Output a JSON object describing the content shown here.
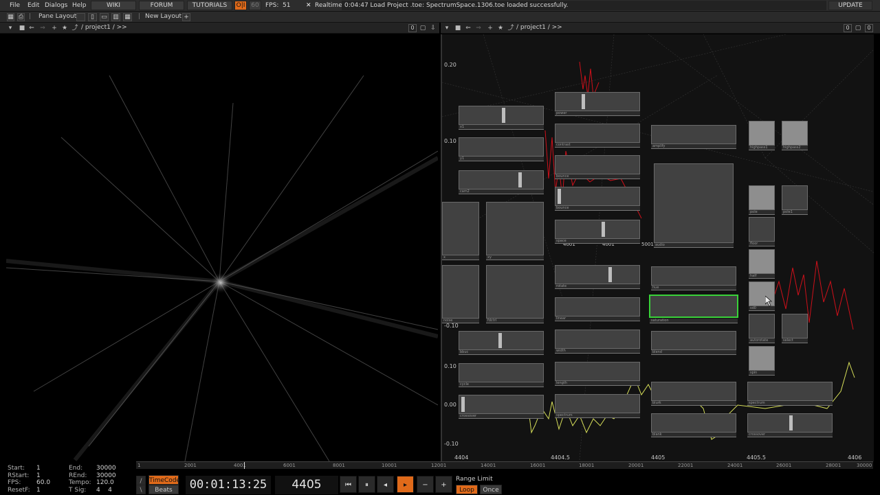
{
  "menu": {
    "file": "File",
    "edit": "Edit",
    "dialogs": "Dialogs",
    "help": "Help",
    "wiki": "WIKI",
    "forum": "FORUM",
    "tutorials": "TUTORIALS",
    "oi": "O|I",
    "fps_cap": "60",
    "fps_label": "FPS:",
    "fps_value": "51",
    "realtime": "Realtime",
    "status": "0:04:47 Load Project .toe: SpectrumSpace.1306.toe loaded successfully.",
    "update": "UPDATE"
  },
  "panebar": {
    "pane_layout": "Pane Layout",
    "new_layout": "New Layout",
    "plus": "+"
  },
  "left_pane": {
    "path": "/ project1 / >>",
    "count": "0"
  },
  "right_pane": {
    "path": "/ project1 / >>",
    "count_a": "0",
    "count_b": "0"
  },
  "network": {
    "y_axis": [
      "0.20",
      "0.10",
      "-0.10",
      "0.10",
      "0.00",
      "-0.10"
    ],
    "x_axis": [
      "4404",
      "4404.5",
      "4405",
      "4405.5",
      "4406"
    ],
    "extra_labels": [
      "4001",
      "4001",
      "5001"
    ],
    "nodes": [
      "x1",
      "y1",
      "cam2",
      "x",
      "xy",
      "noise",
      "fdctrl",
      "bbuc",
      "cycle",
      "power",
      "contrast",
      "bounce",
      "bounce",
      "space",
      "rotate",
      "linear",
      "width",
      "length",
      "amplify",
      "audio",
      "saturation",
      "hue",
      "blend",
      "blurk",
      "blank",
      "highpass1",
      "highpass2",
      "pole",
      "pole1",
      "floor",
      "half",
      "sd0",
      "autorotate",
      "select",
      "spin",
      "spectrum",
      "crossover"
    ]
  },
  "timeline": {
    "ruler": [
      "1",
      "2001",
      "4001",
      "6001",
      "8001",
      "10001",
      "12001",
      "14001",
      "16001",
      "18001",
      "20001",
      "22001",
      "24001",
      "26001",
      "28001",
      "30000"
    ],
    "start_k": "Start:",
    "start_v": "1",
    "rstart_k": "RStart:",
    "rstart_v": "1",
    "fps_k": "FPS:",
    "fps_v": "60.0",
    "resetf_k": "ResetF:",
    "resetf_v": "1",
    "end_k": "End:",
    "end_v": "30000",
    "rend_k": "REnd:",
    "rend_v": "30000",
    "tempo_k": "Tempo:",
    "tempo_v": "120.0",
    "tsig_k": "T Sig:",
    "tsig_v": "4    4",
    "timecode_btn": "TimeCode",
    "beats_btn": "Beats",
    "timecode": "00:01:13:25",
    "frame": "4405",
    "range_limit": "Range Limit",
    "loop": "Loop",
    "once": "Once"
  },
  "colors": {
    "accent": "#e06a1a",
    "selected": "#39d239",
    "red_wave": "#d0101a",
    "yellow_wave": "#d8e05a"
  }
}
